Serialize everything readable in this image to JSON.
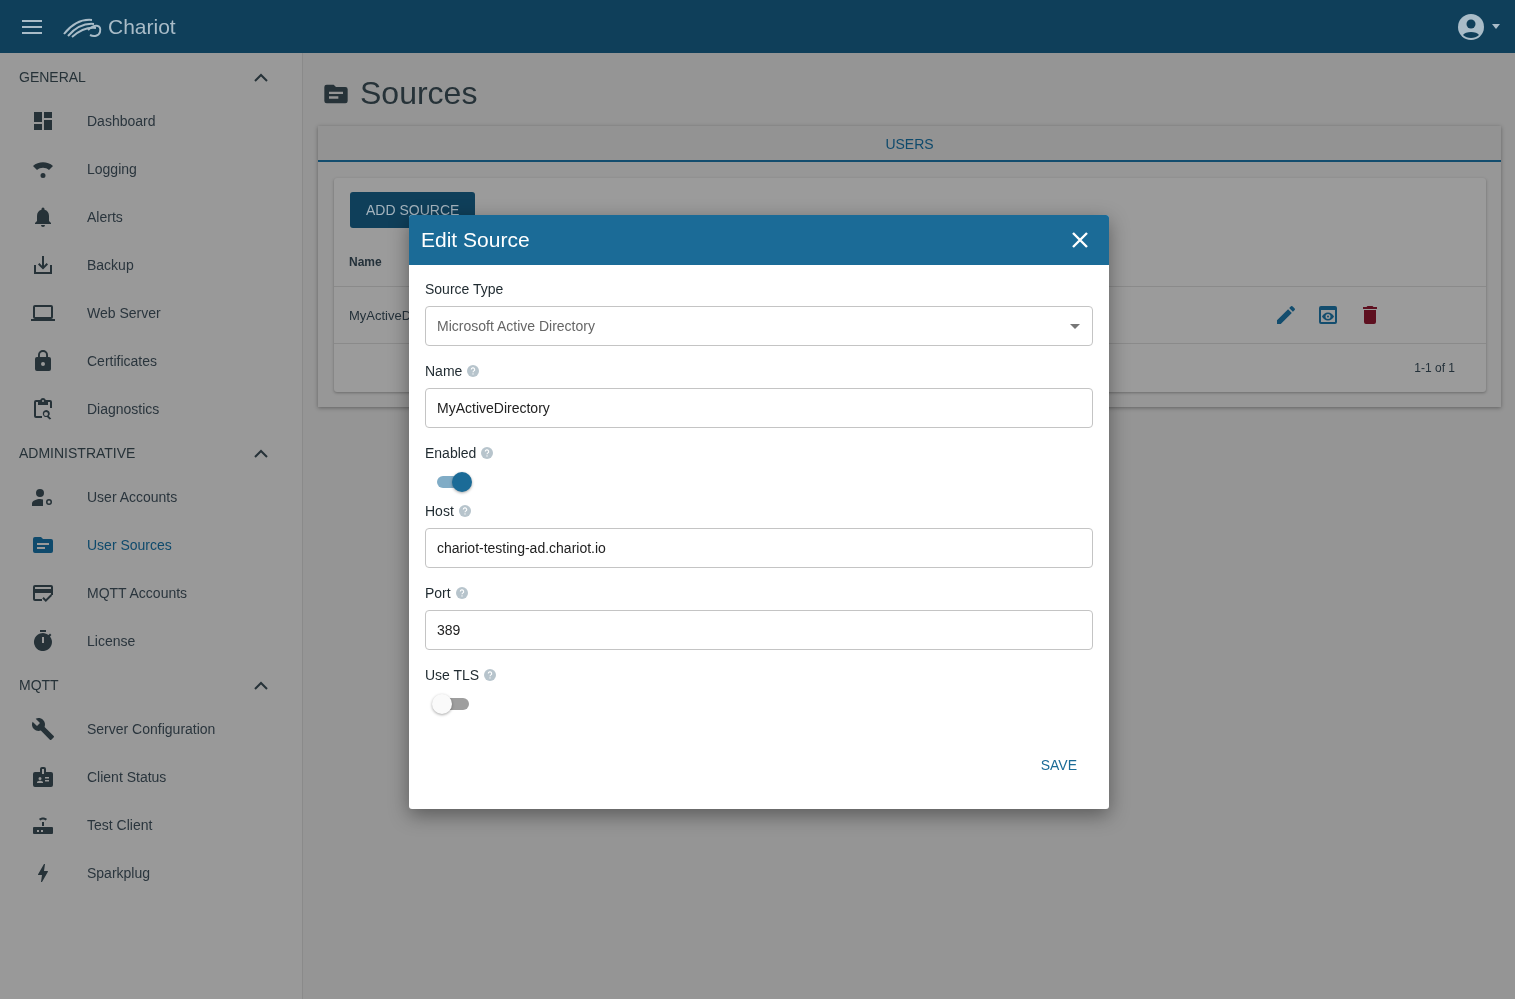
{
  "header": {
    "app_name": "Chariot"
  },
  "sidebar": {
    "sections": [
      {
        "title": "GENERAL",
        "expanded": true,
        "items": [
          {
            "label": "Dashboard",
            "kind": "dashboard",
            "selected": false
          },
          {
            "label": "Logging",
            "kind": "logging",
            "selected": false
          },
          {
            "label": "Alerts",
            "kind": "alerts",
            "selected": false
          },
          {
            "label": "Backup",
            "kind": "backup",
            "selected": false
          },
          {
            "label": "Web Server",
            "kind": "webserver",
            "selected": false
          },
          {
            "label": "Certificates",
            "kind": "certificates",
            "selected": false
          },
          {
            "label": "Diagnostics",
            "kind": "diagnostics",
            "selected": false
          }
        ]
      },
      {
        "title": "ADMINISTRATIVE",
        "expanded": true,
        "items": [
          {
            "label": "User Accounts",
            "kind": "useraccounts",
            "selected": false
          },
          {
            "label": "User Sources",
            "kind": "usersources",
            "selected": true
          },
          {
            "label": "MQTT Accounts",
            "kind": "mqttaccounts",
            "selected": false
          },
          {
            "label": "License",
            "kind": "license",
            "selected": false
          }
        ]
      },
      {
        "title": "MQTT",
        "expanded": true,
        "items": [
          {
            "label": "Server Configuration",
            "kind": "serverconfig",
            "selected": false
          },
          {
            "label": "Client Status",
            "kind": "clientstatus",
            "selected": false
          },
          {
            "label": "Test Client",
            "kind": "testclient",
            "selected": false
          },
          {
            "label": "Sparkplug",
            "kind": "sparkplug",
            "selected": false
          }
        ]
      }
    ]
  },
  "page": {
    "title": "Sources",
    "tabs": [
      {
        "label": "USERS",
        "selected": true
      }
    ],
    "add_button": "ADD SOURCE",
    "table": {
      "columns": [
        "Name"
      ],
      "rows": [
        {
          "name": "MyActiveD"
        }
      ]
    },
    "pagination": "1-1 of 1"
  },
  "dialog": {
    "title": "Edit Source",
    "fields": [
      {
        "kind": "select",
        "label": "Source Type",
        "help": false,
        "value": "Microsoft Active Directory"
      },
      {
        "kind": "text",
        "label": "Name",
        "help": true,
        "value": "MyActiveDirectory"
      },
      {
        "kind": "switch",
        "label": "Enabled",
        "help": true,
        "on": true
      },
      {
        "kind": "text",
        "label": "Host",
        "help": true,
        "value": "chariot-testing-ad.chariot.io"
      },
      {
        "kind": "text",
        "label": "Port",
        "help": true,
        "value": "389"
      },
      {
        "kind": "switch",
        "label": "Use TLS",
        "help": true,
        "on": false
      }
    ],
    "save_button": "SAVE"
  }
}
